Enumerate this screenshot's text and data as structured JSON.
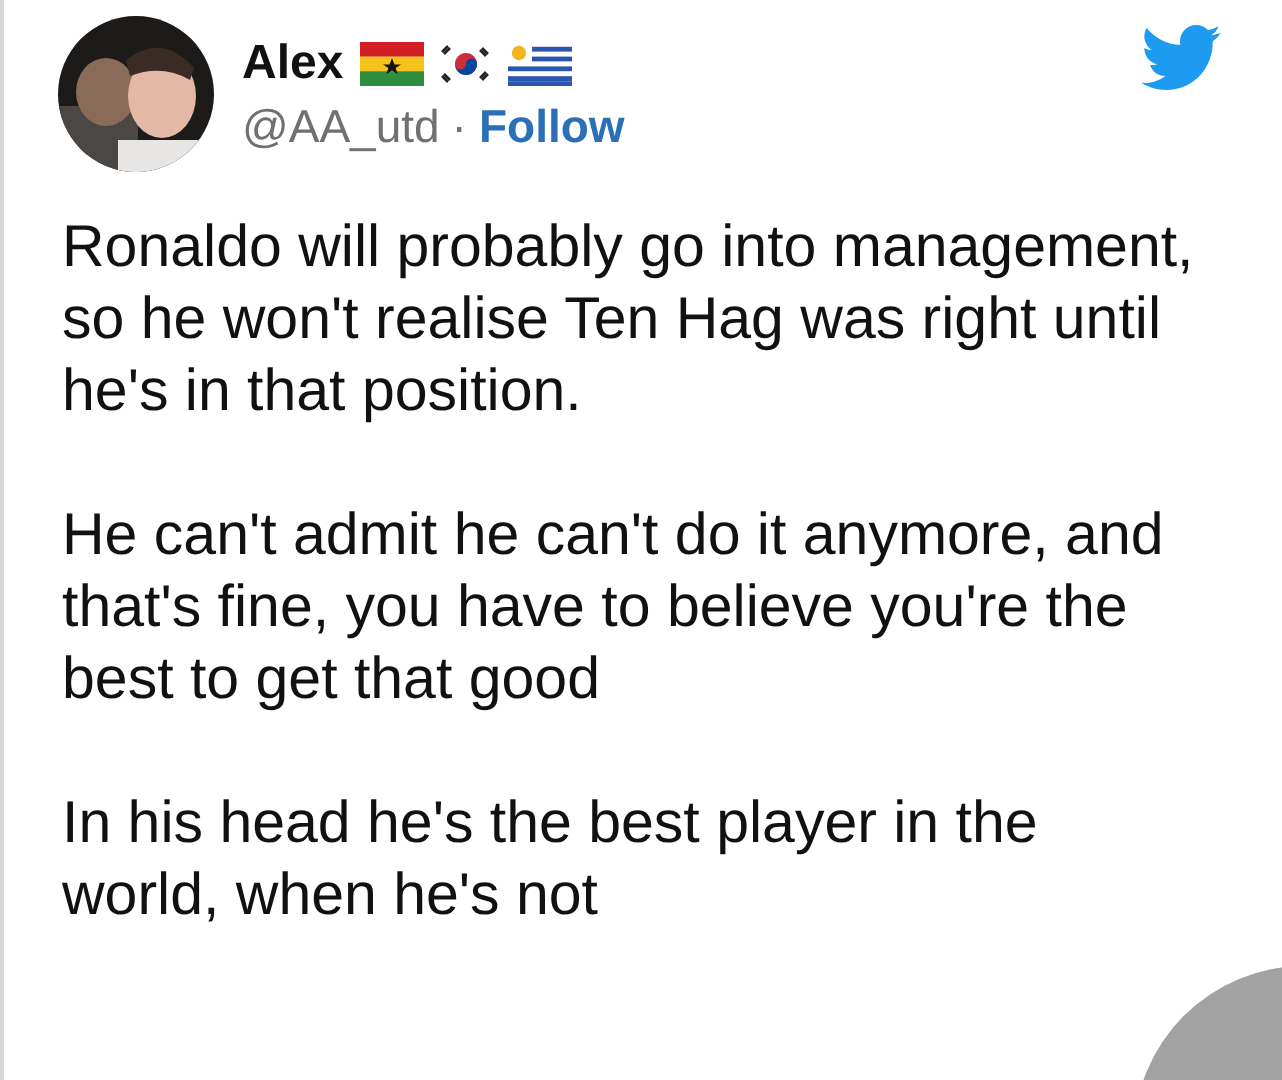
{
  "tweet": {
    "author": {
      "name": "Alex",
      "flags": [
        {
          "kind": "ghana"
        },
        {
          "kind": "korea"
        },
        {
          "kind": "uruguay"
        }
      ],
      "handle": "@AA_utd",
      "separator": "·",
      "follow": "Follow"
    },
    "paragraphs": [
      "Ronaldo will probably go into management, so he won't realise Ten Hag was right until he's in that position.",
      "He can't admit he can't do it anymore, and that's fine, you have to believe you're the best to get that good",
      "In his head he's the best player in the world, when he's not"
    ]
  }
}
